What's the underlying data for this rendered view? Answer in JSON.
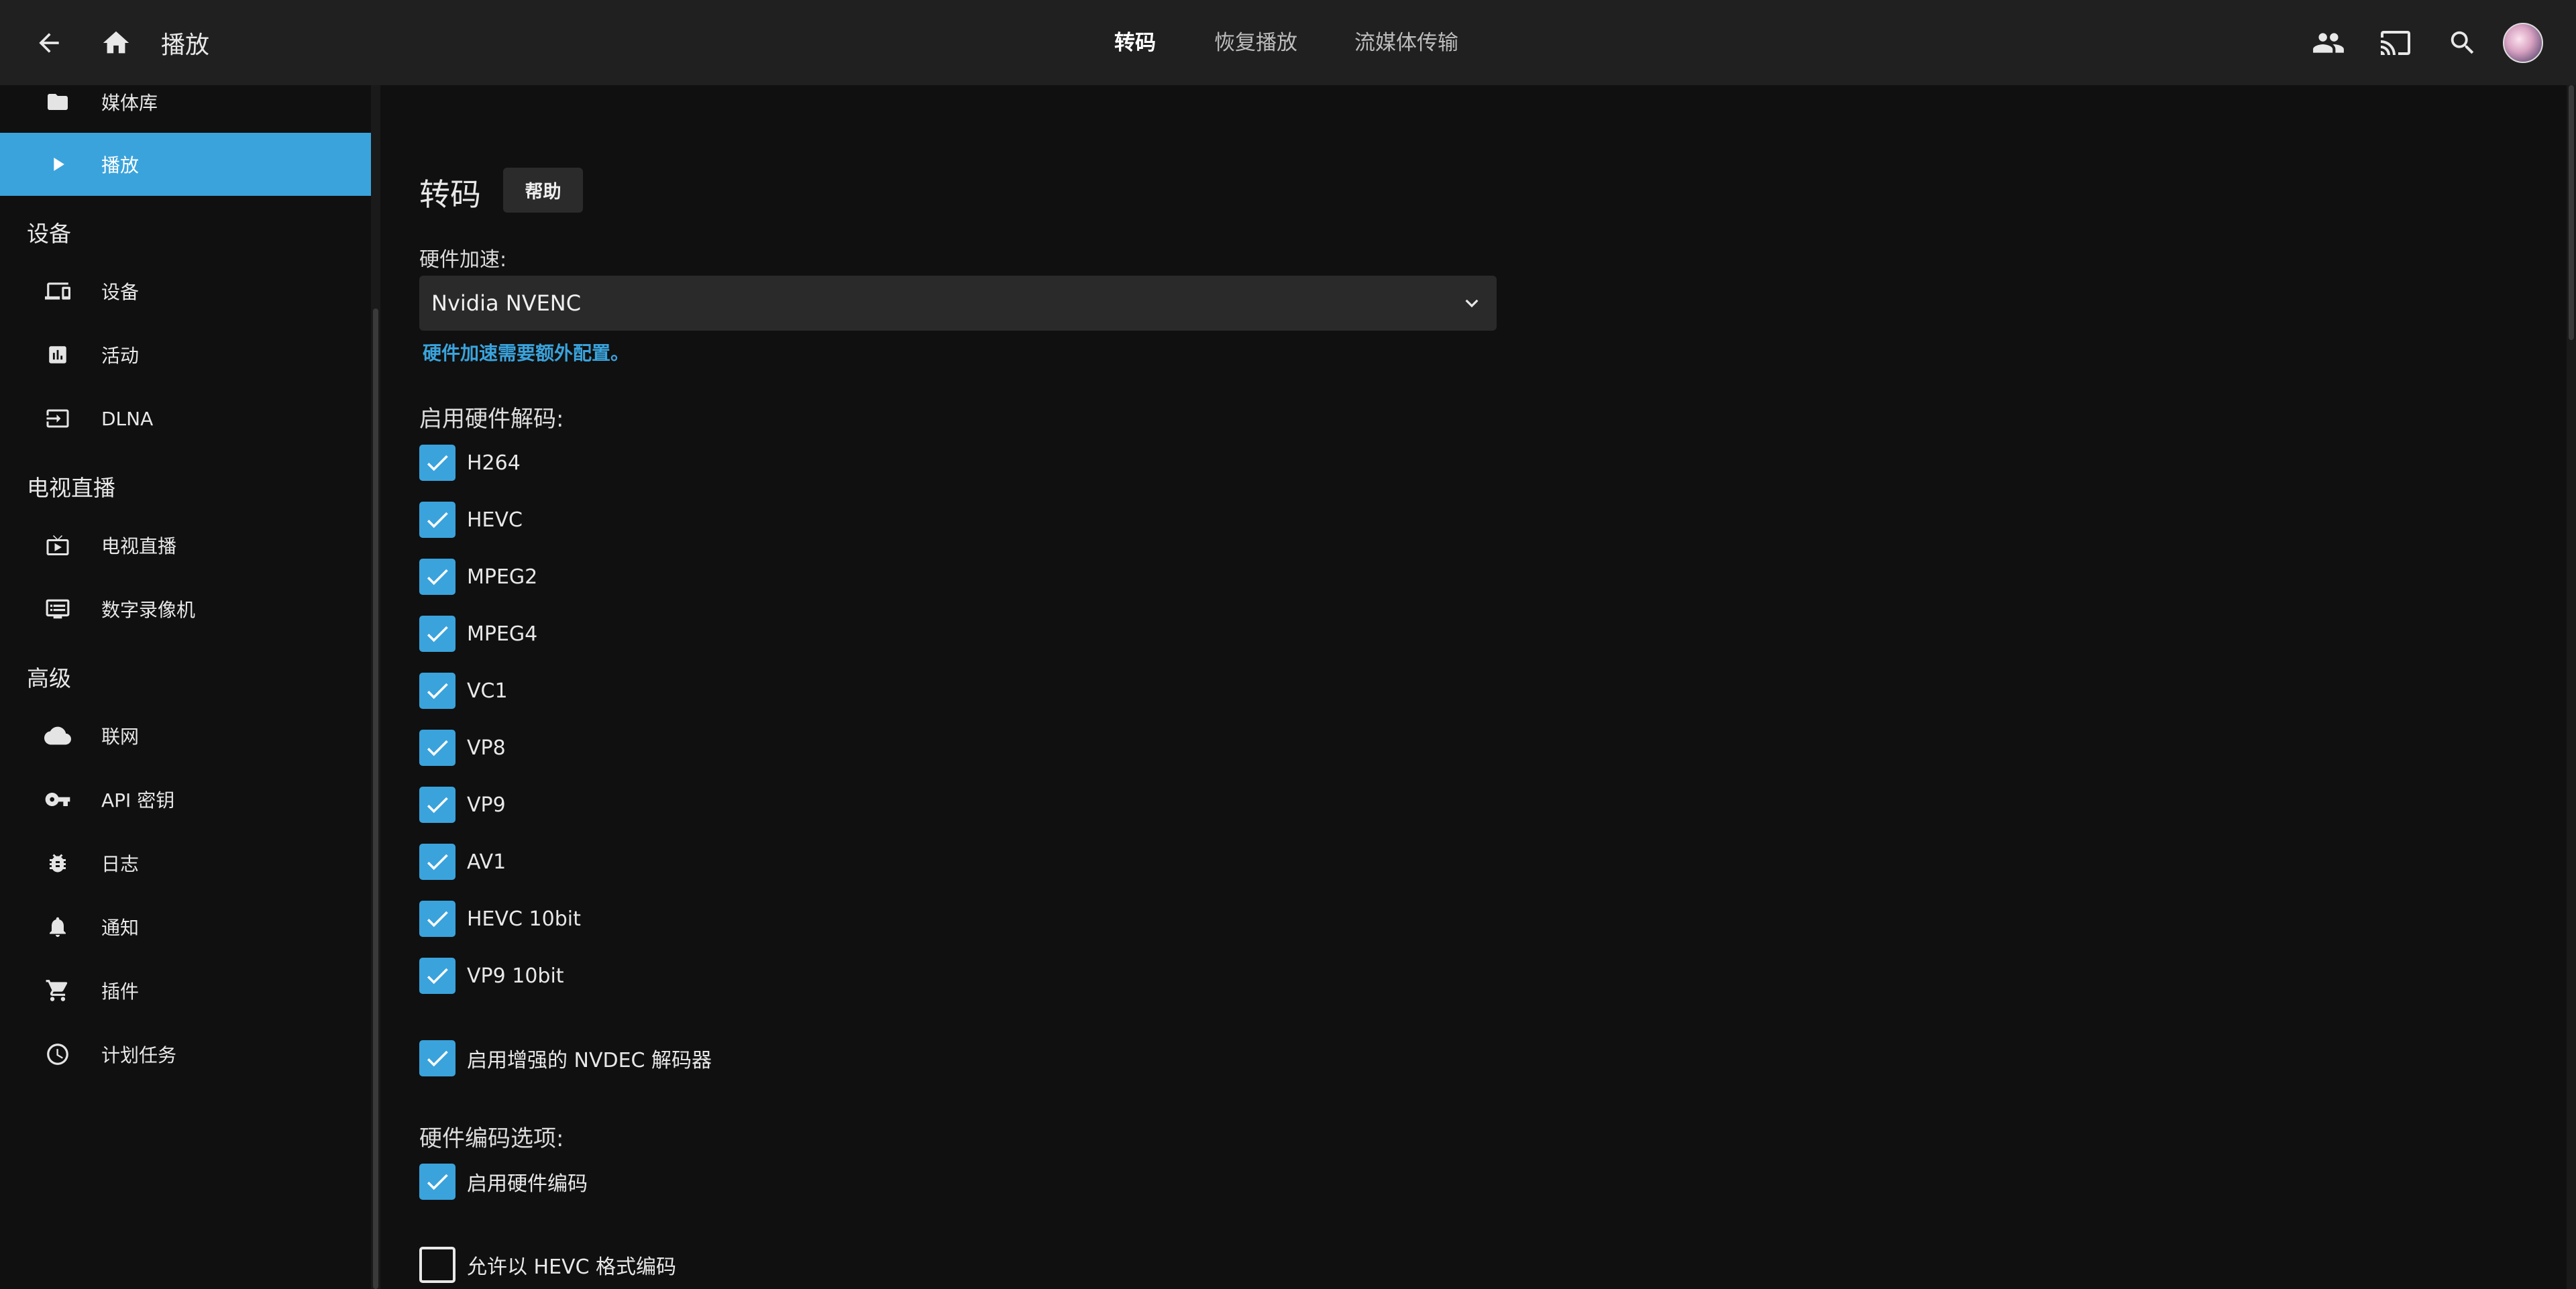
{
  "header": {
    "title": "播放",
    "tabs": [
      {
        "label": "转码",
        "active": true
      },
      {
        "label": "恢复播放",
        "active": false
      },
      {
        "label": "流媒体传输",
        "active": false
      }
    ],
    "icons": [
      "back-arrow-icon",
      "home-icon",
      "users-icon",
      "cast-icon",
      "search-icon",
      "avatar"
    ]
  },
  "sidebar": {
    "items_top": [
      {
        "label": "媒体库",
        "icon": "folder-icon"
      },
      {
        "label": "播放",
        "icon": "play-icon",
        "active": true
      }
    ],
    "groups": [
      {
        "heading": "设备",
        "items": [
          {
            "label": "设备",
            "icon": "devices-icon"
          },
          {
            "label": "活动",
            "icon": "activity-icon"
          },
          {
            "label": "DLNA",
            "icon": "input-icon"
          }
        ]
      },
      {
        "heading": "电视直播",
        "items": [
          {
            "label": "电视直播",
            "icon": "live-tv-icon"
          },
          {
            "label": "数字录像机",
            "icon": "dvr-icon"
          }
        ]
      },
      {
        "heading": "高级",
        "items": [
          {
            "label": "联网",
            "icon": "cloud-icon"
          },
          {
            "label": "API 密钥",
            "icon": "key-icon"
          },
          {
            "label": "日志",
            "icon": "bug-icon"
          },
          {
            "label": "通知",
            "icon": "bell-icon"
          },
          {
            "label": "插件",
            "icon": "cart-icon"
          },
          {
            "label": "计划任务",
            "icon": "clock-icon"
          }
        ]
      }
    ]
  },
  "main": {
    "title": "转码",
    "help_label": "帮助",
    "hw_accel_label": "硬件加速:",
    "hw_accel_value": "Nvidia NVENC",
    "hw_accel_link": "硬件加速需要额外配置。",
    "decode_label": "启用硬件解码:",
    "decoders": [
      {
        "label": "H264",
        "checked": true
      },
      {
        "label": "HEVC",
        "checked": true
      },
      {
        "label": "MPEG2",
        "checked": true
      },
      {
        "label": "MPEG4",
        "checked": true
      },
      {
        "label": "VC1",
        "checked": true
      },
      {
        "label": "VP8",
        "checked": true
      },
      {
        "label": "VP9",
        "checked": true
      },
      {
        "label": "AV1",
        "checked": true
      },
      {
        "label": "HEVC 10bit",
        "checked": true
      },
      {
        "label": "VP9 10bit",
        "checked": true
      }
    ],
    "nvdec_label": "启用增强的 NVDEC 解码器",
    "nvdec_checked": true,
    "encode_label": "硬件编码选项:",
    "enable_hw_encode_label": "启用硬件编码",
    "enable_hw_encode_checked": true,
    "allow_hevc_label": "允许以 HEVC 格式编码",
    "allow_hevc_checked": false
  },
  "colors": {
    "accent": "#3aa3dc",
    "header_bg": "#202020",
    "page_bg": "#101010"
  }
}
